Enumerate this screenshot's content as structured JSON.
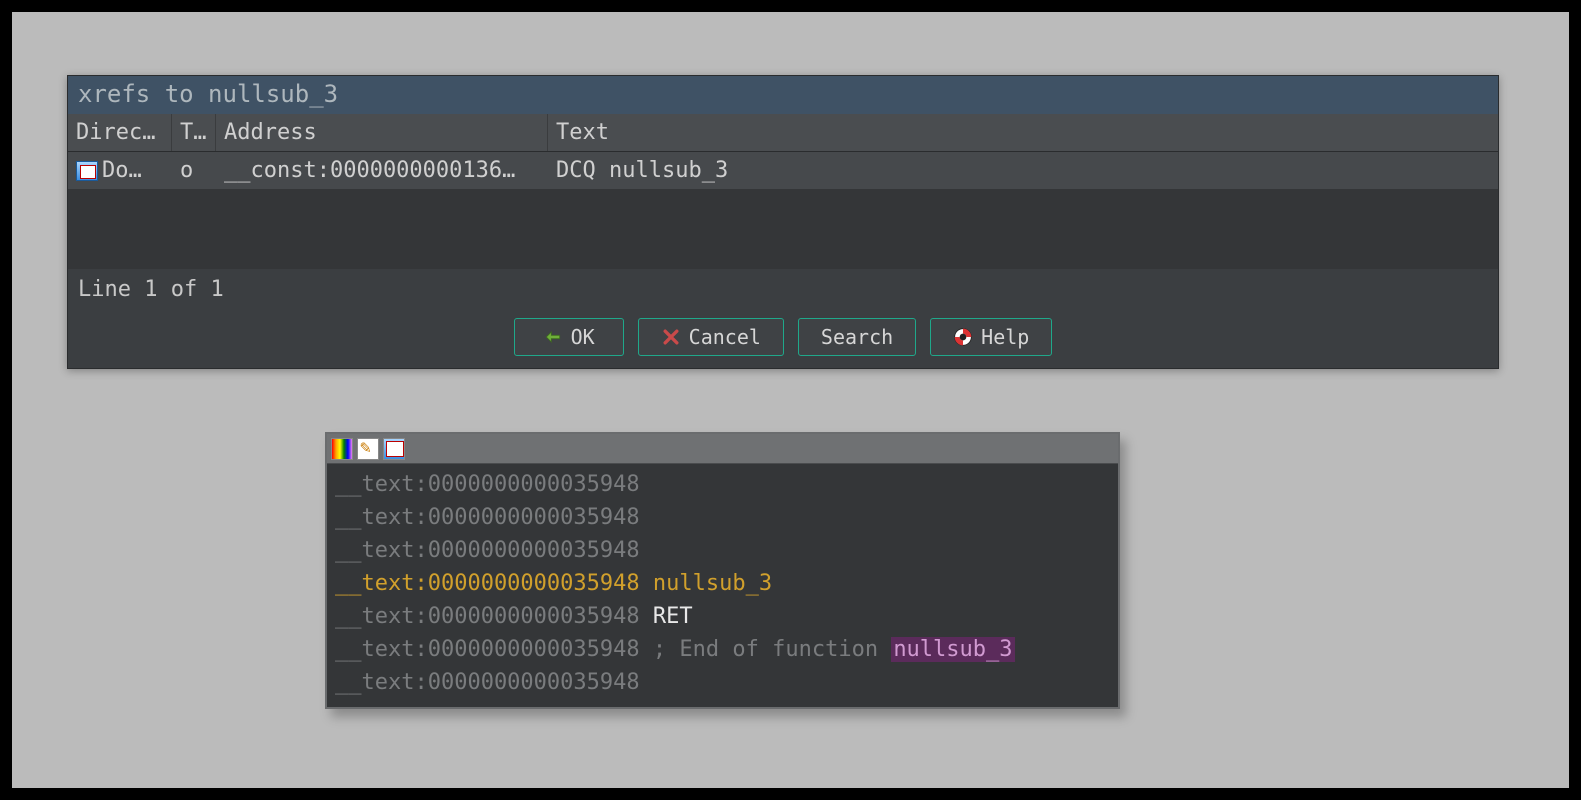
{
  "xrefs": {
    "title": "xrefs to nullsub_3",
    "columns": {
      "direction": "Directi",
      "type": "Typ",
      "address": "Address",
      "text": "Text"
    },
    "rows": [
      {
        "direction": "Do…",
        "type": "o",
        "address": "__const:0000000000136…",
        "text": "DCQ nullsub_3"
      }
    ],
    "status": "Line 1 of 1",
    "buttons": {
      "ok": "OK",
      "cancel": "Cancel",
      "search": "Search",
      "help": "Help"
    }
  },
  "disasm": {
    "seg": "__text",
    "addr": "0000000000035948",
    "lines": [
      {
        "segaddr": "__text:0000000000035948",
        "rest": "",
        "style": "dim"
      },
      {
        "segaddr": "__text:0000000000035948",
        "rest": "",
        "style": "dim"
      },
      {
        "segaddr": "__text:0000000000035948",
        "rest": "",
        "style": "dim"
      },
      {
        "segaddr": "__text:0000000000035948",
        "rest": "nullsub_3",
        "style": "hl-name"
      },
      {
        "segaddr": "__text:0000000000035948",
        "rest": "RET",
        "style": "instr"
      },
      {
        "segaddr": "__text:0000000000035948",
        "rest": "; End of function",
        "ref": "nullsub_3",
        "style": "comment-ref"
      },
      {
        "segaddr": "__text:0000000000035948",
        "rest": "",
        "style": "dim"
      }
    ]
  }
}
